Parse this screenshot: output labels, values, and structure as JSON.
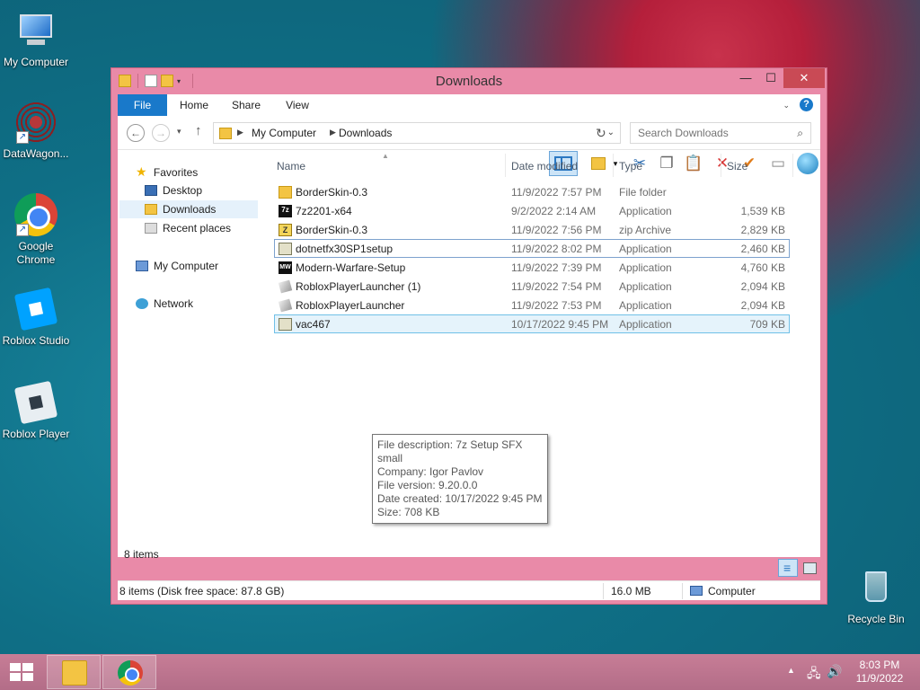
{
  "desktop": {
    "icons": [
      {
        "label": "My Computer"
      },
      {
        "label": "DataWagon..."
      },
      {
        "label": "Google Chrome"
      },
      {
        "label": "Roblox Studio"
      },
      {
        "label": "Roblox Player"
      },
      {
        "label": "Recycle Bin"
      }
    ]
  },
  "window": {
    "title": "Downloads",
    "min_glyph": "—",
    "max_glyph": "☐",
    "close_glyph": "✕"
  },
  "ribbon": {
    "tabs": [
      "File",
      "Home",
      "Share",
      "View"
    ],
    "collapse_glyph": "⌄",
    "help_glyph": "?"
  },
  "nav": {
    "back_glyph": "←",
    "forward_glyph": "→",
    "recent_glyph": "▾",
    "up_glyph": "↑",
    "breadcrumb": [
      "My Computer",
      "Downloads"
    ],
    "refresh_glyph": "↻",
    "search_placeholder": "Search Downloads",
    "search_glyph": "⌕"
  },
  "toolbar": {
    "cut_glyph": "✂",
    "copy_glyph": "❐",
    "paste_glyph": "📋",
    "delete_glyph": "✕",
    "rename_glyph": "✔",
    "props_dd_glyph": "▾",
    "more_glyph": "▭"
  },
  "navpane": {
    "favorites": "Favorites",
    "desktop": "Desktop",
    "downloads": "Downloads",
    "recent": "Recent places",
    "computer": "My Computer",
    "network": "Network"
  },
  "columns": {
    "name": "Name",
    "date": "Date modified",
    "type": "Type",
    "size": "Size"
  },
  "files": [
    {
      "name": "BorderSkin-0.3",
      "date": "11/9/2022 7:57 PM",
      "type": "File folder",
      "size": "",
      "icon": "folder-icon"
    },
    {
      "name": "7z2201-x64",
      "date": "9/2/2022 2:14 AM",
      "type": "Application",
      "size": "1,539 KB",
      "icon": "7zip-icon"
    },
    {
      "name": "BorderSkin-0.3",
      "date": "11/9/2022 7:56 PM",
      "type": "zip Archive",
      "size": "2,829 KB",
      "icon": "zip-icon"
    },
    {
      "name": "dotnetfx30SP1setup",
      "date": "11/9/2022 8:02 PM",
      "type": "Application",
      "size": "2,460 KB",
      "icon": "setup-icon"
    },
    {
      "name": "Modern-Warfare-Setup",
      "date": "11/9/2022 7:39 PM",
      "type": "Application",
      "size": "4,760 KB",
      "icon": "mw-icon"
    },
    {
      "name": "RobloxPlayerLauncher (1)",
      "date": "11/9/2022 7:54 PM",
      "type": "Application",
      "size": "2,094 KB",
      "icon": "roblox-icon"
    },
    {
      "name": "RobloxPlayerLauncher",
      "date": "11/9/2022 7:53 PM",
      "type": "Application",
      "size": "2,094 KB",
      "icon": "roblox-icon"
    },
    {
      "name": "vac467",
      "date": "10/17/2022 9:45 PM",
      "type": "Application",
      "size": "709 KB",
      "icon": "setup-icon"
    }
  ],
  "tooltip": {
    "lines": [
      "File description: 7z Setup SFX small",
      "Company: Igor Pavlov",
      "File version: 9.20.0.0",
      "Date created: 10/17/2022 9:45 PM",
      "Size: 708 KB"
    ]
  },
  "status": {
    "item_count": "8 items",
    "disk_info": "8 items (Disk free space: 87.8 GB)",
    "size": "16.0 MB",
    "location": "Computer"
  },
  "taskbar": {
    "tray_arrow": "▲",
    "net_glyph": "🖧",
    "vol_glyph": "🔊",
    "time": "8:03 PM",
    "date": "11/9/2022"
  }
}
